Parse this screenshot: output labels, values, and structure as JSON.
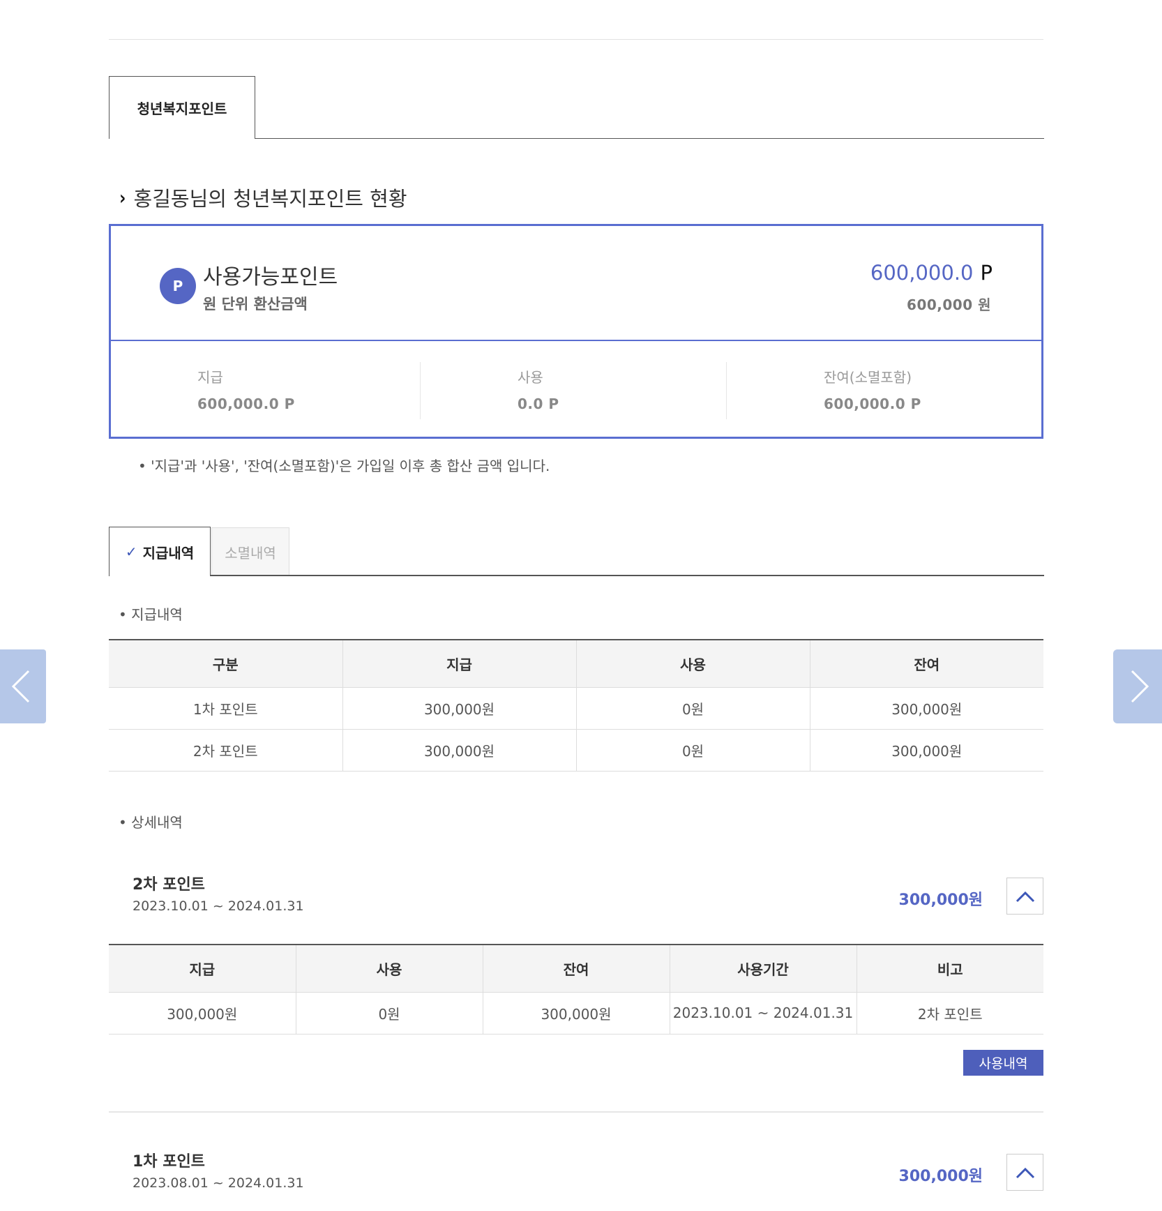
{
  "main_tab": {
    "label": "청년복지포인트"
  },
  "section": {
    "title": "홍길동님의 청년복지포인트 현황"
  },
  "card": {
    "badge": "P",
    "available_label": "사용가능포인트",
    "conversion_label": "원 단위 환산금액",
    "available_value": "600,000.0",
    "available_unit": "P",
    "conversion_value": "600,000 원",
    "stats": [
      {
        "label": "지급",
        "value": "600,000.0 P"
      },
      {
        "label": "사용",
        "value": "0.0 P"
      },
      {
        "label": "잔여(소멸포함)",
        "value": "600,000.0 P"
      }
    ]
  },
  "note": "• '지급'과 '사용', '잔여(소멸포함)'은 가입일 이후 총 합산 금액 입니다.",
  "sub_tabs": [
    {
      "label": "지급내역",
      "active": true
    },
    {
      "label": "소멸내역",
      "active": false
    }
  ],
  "summary": {
    "label": "• 지급내역",
    "headers": [
      "구분",
      "지급",
      "사용",
      "잔여"
    ],
    "rows": [
      [
        "1차 포인트",
        "300,000원",
        "0원",
        "300,000원"
      ],
      [
        "2차 포인트",
        "300,000원",
        "0원",
        "300,000원"
      ]
    ]
  },
  "details": {
    "label": "• 상세내역",
    "groups": [
      {
        "title": "2차 포인트",
        "period": "2023.10.01 ~ 2024.01.31",
        "amount": "300,000원",
        "headers": [
          "지급",
          "사용",
          "잔여",
          "사용기간",
          "비고"
        ],
        "row": [
          "300,000원",
          "0원",
          "300,000원",
          "2023.10.01 ~ 2024.01.31",
          "2차 포인트"
        ],
        "button": "사용내역"
      },
      {
        "title": "1차 포인트",
        "period": "2023.08.01 ~ 2024.01.31",
        "amount": "300,000원"
      }
    ]
  },
  "colors": {
    "accent": "#5566c4",
    "border": "#5a6ed1",
    "nav_arrow": "#b5c7e8"
  },
  "icons": {
    "prev": "chevron-left-icon",
    "next": "chevron-right-icon",
    "collapse": "chevron-up-icon",
    "check": "check-icon"
  }
}
